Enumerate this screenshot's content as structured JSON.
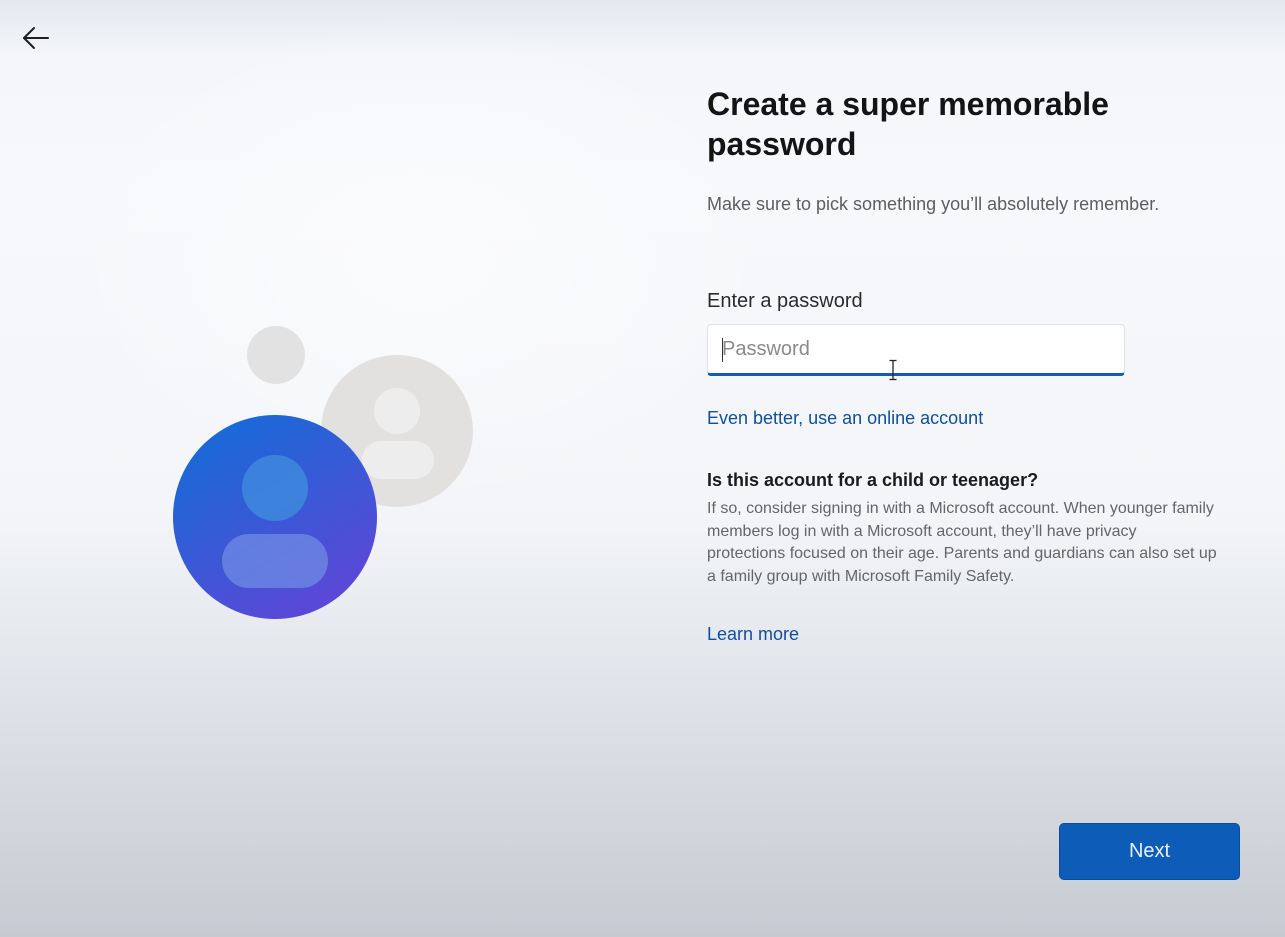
{
  "header": {
    "back_icon": "arrow-left-icon"
  },
  "illustration": {
    "icon": "person-avatars-illustration",
    "colors": {
      "primary_avatar_top": "#0e6fd8",
      "primary_avatar_bottom": "#5a48d6",
      "secondary_avatar": "#e3e2e2"
    }
  },
  "main": {
    "title": "Create a super memorable password",
    "subtitle": "Make sure to pick something you’ll absolutely remember.",
    "password_label": "Enter a password",
    "password_placeholder": "Password",
    "password_value": "",
    "online_account_link": "Even better, use an online account",
    "child_heading": "Is this account for a child or teenager?",
    "child_body": "If so, consider signing in with a Microsoft account. When younger family members log in with a Microsoft account, they’ll have privacy protections focused on their age. Parents and guardians can also set up a family group with Microsoft Family Safety.",
    "learn_more_link": "Learn more"
  },
  "footer": {
    "next_label": "Next"
  },
  "colors": {
    "accent": "#0d5db8",
    "link": "#0f4f9c"
  }
}
